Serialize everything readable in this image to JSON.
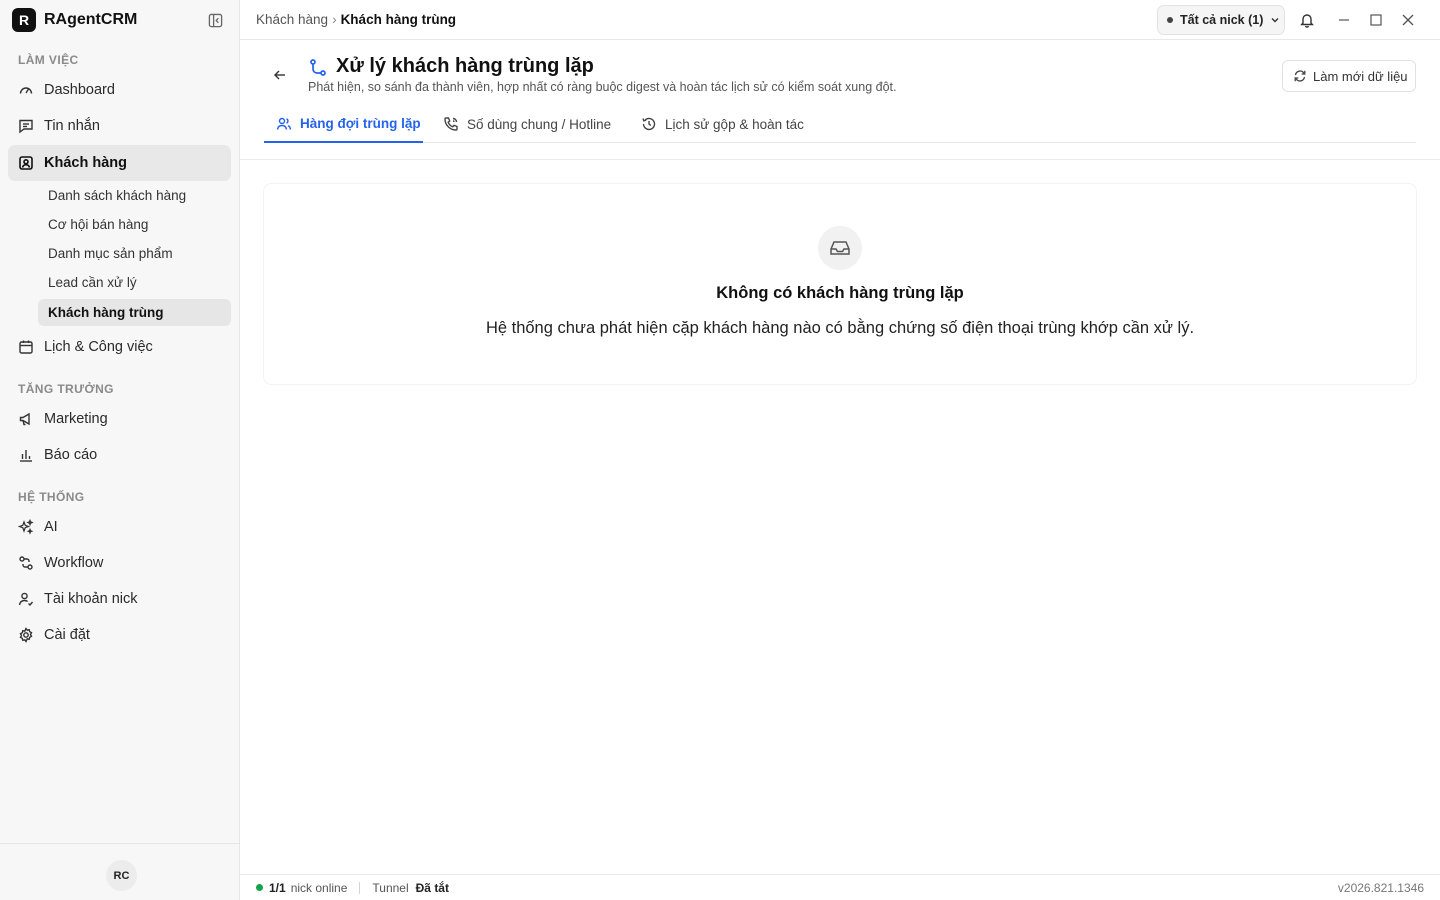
{
  "app": {
    "logo_letter": "R",
    "name": "RAgentCRM"
  },
  "sidebar": {
    "sections": {
      "work": "LÀM VIỆC",
      "growth": "TĂNG TRƯỞNG",
      "system": "HỆ THỐNG"
    },
    "items": {
      "dashboard": "Dashboard",
      "messages": "Tin nhắn",
      "customers": "Khách hàng",
      "calendar": "Lịch & Công việc",
      "marketing": "Marketing",
      "reports": "Báo cáo",
      "ai": "AI",
      "workflow": "Workflow",
      "nick_accounts": "Tài khoản nick",
      "settings": "Cài đặt"
    },
    "customer_subitems": {
      "list": "Danh sách khách hàng",
      "opportunities": "Cơ hội bán hàng",
      "products": "Danh mục sản phẩm",
      "leads": "Lead cần xử lý",
      "duplicates": "Khách hàng trùng"
    },
    "avatar_initials": "RC"
  },
  "topbar": {
    "breadcrumb_parent": "Khách hàng",
    "breadcrumb_sep": "›",
    "breadcrumb_current": "Khách hàng trùng",
    "nick_selector": "Tất cả nick (1)"
  },
  "page": {
    "title": "Xử lý khách hàng trùng lặp",
    "subtitle": "Phát hiện, so sánh đa thành viên, hợp nhất có ràng buộc digest và hoàn tác lịch sử có kiểm soát xung đột.",
    "refresh_label": "Làm mới dữ liệu"
  },
  "tabs": [
    {
      "label": "Hàng đợi trùng lặp",
      "active": true,
      "icon": "users-icon"
    },
    {
      "label": "Số dùng chung / Hotline",
      "active": false,
      "icon": "phone-icon"
    },
    {
      "label": "Lịch sử gộp & hoàn tác",
      "active": false,
      "icon": "history-icon"
    }
  ],
  "empty_state": {
    "title": "Không có khách hàng trùng lặp",
    "description": "Hệ thống chưa phát hiện cặp khách hàng nào có bằng chứng số điện thoại trùng khớp cần xử lý.",
    "icon": "inbox-icon"
  },
  "status_bar": {
    "online_count": "1/1",
    "online_label": "nick online",
    "tunnel_label": "Tunnel",
    "tunnel_value": "Đã tắt",
    "version": "v2026.821.1346"
  },
  "colors": {
    "accent": "#2563eb",
    "online": "#16a34a"
  }
}
